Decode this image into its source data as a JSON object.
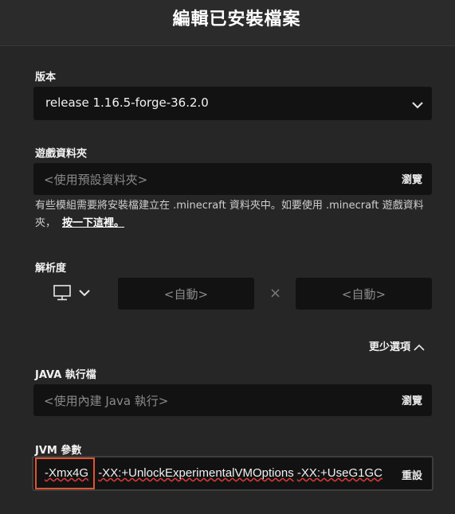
{
  "title": "編輯已安裝檔案",
  "version": {
    "label": "版本",
    "value": "release 1.16.5-forge-36.2.0",
    "icon": "chevron-down-icon"
  },
  "game_dir": {
    "label": "遊戲資料夾",
    "placeholder": "<使用預設資料夾>",
    "browse_label": "瀏覽",
    "note": "有些模組需要將安裝檔建立在 .minecraft 資料夾中。如要使用 .minecraft 遊戲資料夾，",
    "note_link": "按一下這裡。"
  },
  "resolution": {
    "label": "解析度",
    "width_placeholder": "<自動>",
    "height_placeholder": "<自動>",
    "separator": "×",
    "icon": "monitor-icon"
  },
  "fewer_options": {
    "label": "更少選項",
    "icon": "chevron-up-icon"
  },
  "java": {
    "label": "JAVA 執行檔",
    "placeholder": "<使用內建 Java 執行>",
    "browse_label": "瀏覽"
  },
  "jvm": {
    "label": "JVM 參數",
    "selected": "-Xmx4G",
    "part1": "-XX:+UnlockExperimentalVMOptions",
    "part2": "-XX:+UseG1GC",
    "reset_label": "重設"
  },
  "colors": {
    "background": "#262626",
    "input_bg": "#121212",
    "selection_border": "#e0552f",
    "spellcheck": "#e03a3a"
  }
}
